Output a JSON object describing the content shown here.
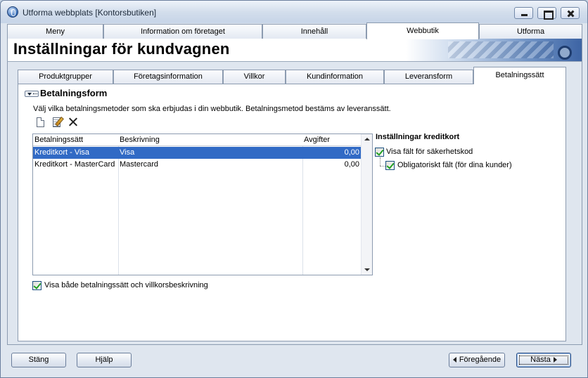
{
  "window": {
    "title": "Utforma webbplats [Kontorsbutiken]"
  },
  "main_tabs": [
    {
      "label": "Meny",
      "active": false
    },
    {
      "label": "Information om företaget",
      "active": false
    },
    {
      "label": "Innehåll",
      "active": false
    },
    {
      "label": "Webbutik",
      "active": true
    },
    {
      "label": "Utforma",
      "active": false
    }
  ],
  "page": {
    "title": "Inställningar för kundvagnen"
  },
  "sub_tabs": [
    {
      "label": "Produktgrupper",
      "active": false
    },
    {
      "label": "Företagsinformation",
      "active": false
    },
    {
      "label": "Villkor",
      "active": false
    },
    {
      "label": "Kundinformation",
      "active": false
    },
    {
      "label": "Leveransform",
      "active": false
    },
    {
      "label": "Betalningssätt",
      "active": true
    }
  ],
  "section": {
    "title": "Betalningsform",
    "description": "Välj vilka betalningsmetoder som ska erbjudas i din webbutik. Betalningsmetod bestäms av leveranssätt."
  },
  "toolbar": {
    "icons": [
      "new-icon",
      "edit-icon",
      "delete-icon"
    ]
  },
  "grid": {
    "columns": [
      "Betalningssätt",
      "Beskrivning",
      "Avgifter"
    ],
    "rows": [
      {
        "method": "Kreditkort - Visa",
        "description": "Visa",
        "fee": "0,00",
        "selected": true
      },
      {
        "method": "Kreditkort - MasterCard",
        "description": "Mastercard",
        "fee": "0,00",
        "selected": false
      }
    ]
  },
  "options": {
    "show_both_label": "Visa både betalningssätt och villkorsbeskrivning",
    "show_both_checked": true
  },
  "credit_card": {
    "title": "Inställningar kreditkort",
    "security_code_label": "Visa fält för säkerhetskod",
    "security_code_checked": true,
    "mandatory_label": "Obligatoriskt fält (för dina kunder)",
    "mandatory_checked": true
  },
  "footer": {
    "close_label": "Stäng",
    "help_label": "Hjälp",
    "prev_label": "Föregående",
    "next_label": "Nästa"
  },
  "colors": {
    "selection": "#316ac5",
    "check_green": "#21a121"
  }
}
